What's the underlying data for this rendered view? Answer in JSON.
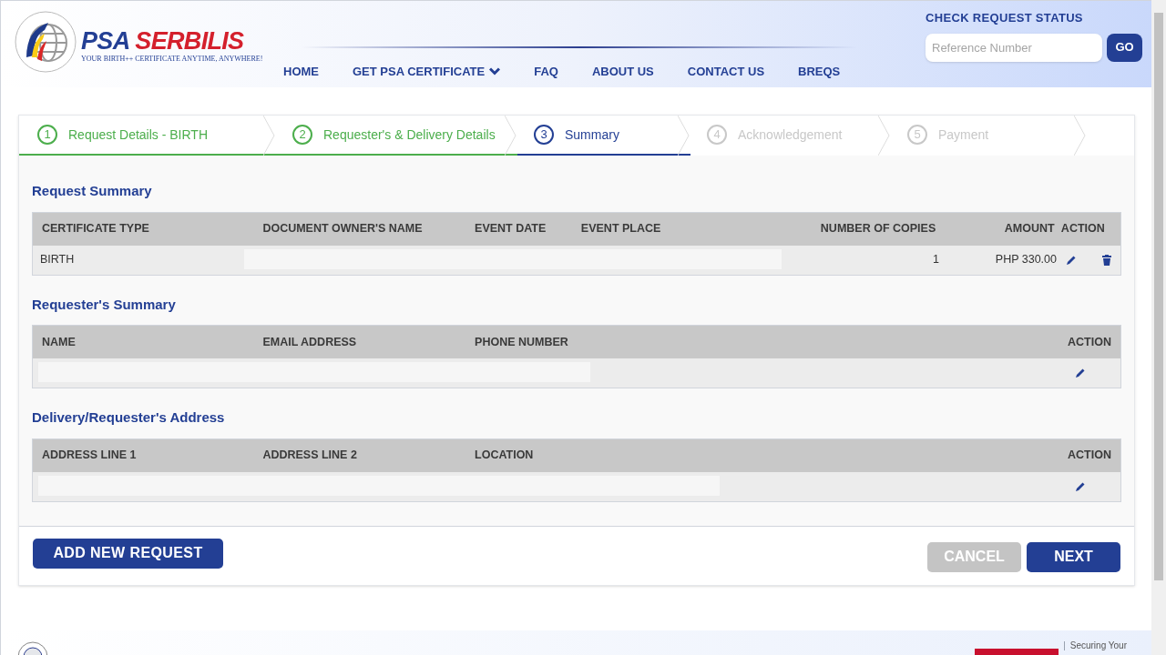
{
  "header": {
    "brand": "PSA SERBILIS",
    "tagline": "YOUR BIRTH++ CERTIFICATE ANYTIME, ANYWHERE!",
    "nav": [
      {
        "label": "HOME",
        "dropdown": false
      },
      {
        "label": "GET PSA CERTIFICATE",
        "dropdown": true
      },
      {
        "label": "FAQ",
        "dropdown": false
      },
      {
        "label": "ABOUT US",
        "dropdown": false
      },
      {
        "label": "CONTACT US",
        "dropdown": false
      },
      {
        "label": "BREQS",
        "dropdown": false
      }
    ],
    "status_check": {
      "title": "CHECK REQUEST STATUS",
      "placeholder": "Reference Number",
      "button": "GO"
    }
  },
  "steps": [
    {
      "number": "1",
      "label": "Request Details - BIRTH",
      "completed": true,
      "selected": false
    },
    {
      "number": "2",
      "label": "Requester's & Delivery Details",
      "completed": true,
      "selected": false
    },
    {
      "number": "3",
      "label": "Summary",
      "completed": false,
      "selected": true
    },
    {
      "number": "4",
      "label": "Acknowledgement",
      "completed": false,
      "selected": false
    },
    {
      "number": "5",
      "label": "Payment",
      "completed": false,
      "selected": false
    }
  ],
  "sections": [
    {
      "title": "Request Summary",
      "columns": [
        "CERTIFICATE TYPE",
        "DOCUMENT OWNER'S NAME",
        "EVENT DATE",
        "EVENT PLACE",
        "NUMBER OF COPIES",
        "AMOUNT",
        "ACTION"
      ],
      "row": {
        "cells": [
          "BIRTH",
          "1",
          "PHP 330.00"
        ],
        "actions": [
          {
            "kind": "edit"
          },
          {
            "kind": "delete"
          }
        ]
      }
    },
    {
      "title": "Requester's Summary",
      "columns": [
        "NAME",
        "EMAIL ADDRESS",
        "PHONE NUMBER",
        "ACTION"
      ],
      "row": {
        "actions": [
          {
            "kind": "edit"
          }
        ]
      }
    },
    {
      "title": "Delivery/Requester's Address",
      "columns": [
        "ADDRESS LINE 1",
        "ADDRESS LINE 2",
        "LOCATION",
        "ACTION"
      ],
      "row": {
        "actions": [
          {
            "kind": "edit"
          }
        ]
      }
    }
  ],
  "buttons": {
    "add": "ADD NEW REQUEST",
    "cancel": {
      "label": "CANCEL",
      "disabled": true
    },
    "next": "NEXT"
  },
  "footer": {
    "tagline": "Securing Your"
  }
}
